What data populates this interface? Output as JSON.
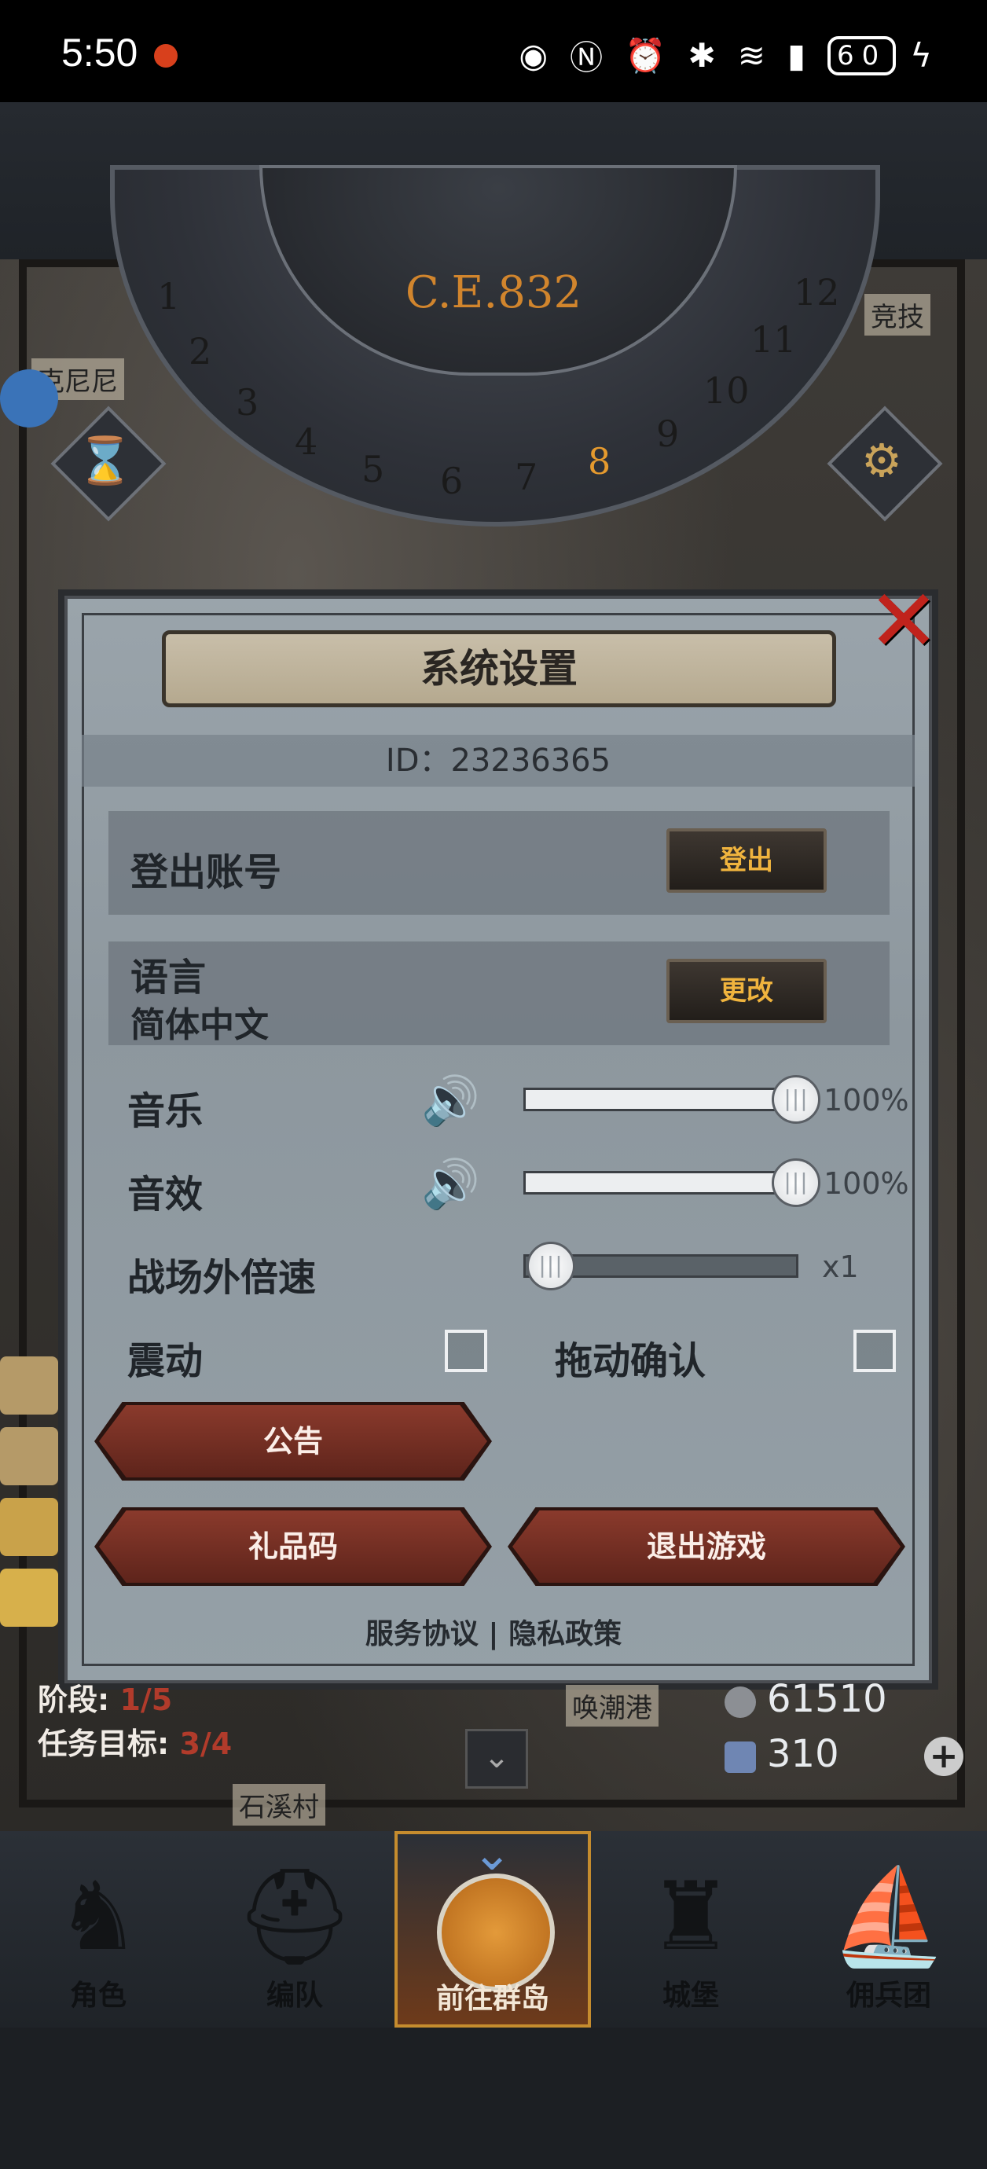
{
  "status_bar": {
    "time": "5:50",
    "battery": "60",
    "icons": [
      "eye-icon",
      "nfc-icon",
      "alarm-icon",
      "bluetooth-icon",
      "wifi-icon",
      "signal-icon",
      "charging-icon"
    ]
  },
  "map": {
    "era": "C.E.832",
    "dial_numbers": [
      "1",
      "2",
      "3",
      "4",
      "5",
      "6",
      "7",
      "8",
      "9",
      "10",
      "11",
      "12"
    ],
    "active_number": "8",
    "labels": {
      "top_left": "克尼尼",
      "top_right": "竞技",
      "harbor": "唤潮港",
      "village": "石溪村"
    }
  },
  "dialog": {
    "title": "系统设置",
    "id_text": "ID：23236365",
    "logout": {
      "label": "登出账号",
      "button": "登出"
    },
    "language": {
      "label": "语言",
      "current": "简体中文",
      "button": "更改"
    },
    "music": {
      "label": "音乐",
      "value": 100,
      "value_text": "100%"
    },
    "sfx": {
      "label": "音效",
      "value": 100,
      "value_text": "100%"
    },
    "battle_speed": {
      "label": "战场外倍速",
      "value_text": "x1"
    },
    "vibration": {
      "label": "震动",
      "checked": false
    },
    "drag_confirm": {
      "label": "拖动确认",
      "checked": false
    },
    "buttons": {
      "announcement": "公告",
      "gift_code": "礼品码",
      "exit_game": "退出游戏"
    },
    "links": {
      "service": "服务协议",
      "separator": "|",
      "privacy": "隐私政策"
    }
  },
  "hud": {
    "stage_label": "阶段:",
    "stage_value": "1/5",
    "task_label": "任务目标:",
    "task_value": "3/4",
    "coins": "61510",
    "crystals": "310"
  },
  "bottom_nav": [
    {
      "label": "角色",
      "icon": "knight-icon"
    },
    {
      "label": "编队",
      "icon": "helmet-icon"
    },
    {
      "label": "前往群岛",
      "icon": "globe-icon",
      "active": true
    },
    {
      "label": "城堡",
      "icon": "castle-icon"
    },
    {
      "label": "佣兵团",
      "icon": "ship-icon"
    }
  ]
}
